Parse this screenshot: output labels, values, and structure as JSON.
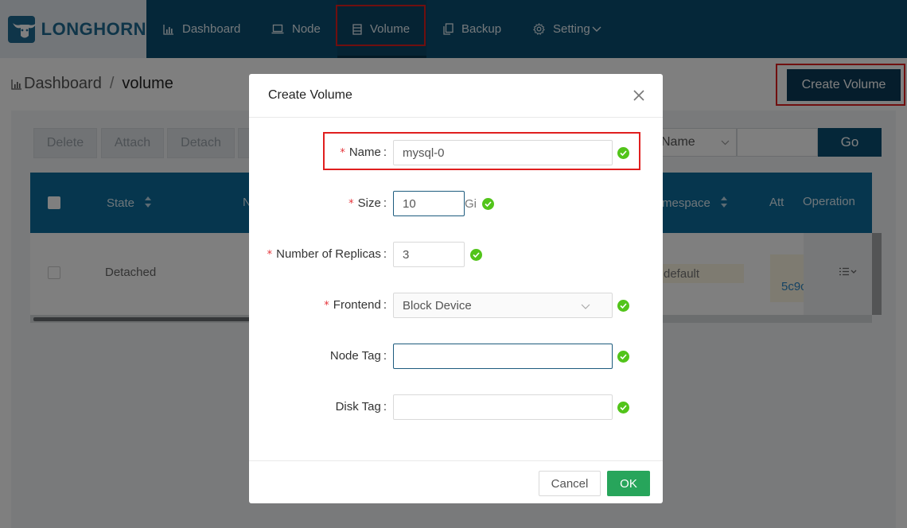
{
  "app": {
    "logo_text": "LONGHORN"
  },
  "nav": {
    "items": [
      {
        "label": "Dashboard",
        "icon": "bar-chart-icon"
      },
      {
        "label": "Node",
        "icon": "laptop-icon"
      },
      {
        "label": "Volume",
        "icon": "storage-icon",
        "active": true
      },
      {
        "label": "Backup",
        "icon": "copy-icon"
      },
      {
        "label": "Setting",
        "icon": "gear-icon"
      }
    ]
  },
  "breadcrumb": {
    "root": "Dashboard",
    "separator": "/",
    "current": "volume"
  },
  "header": {
    "create_label": "Create Volume"
  },
  "toolbar": {
    "delete_label": "Delete",
    "attach_label": "Attach",
    "detach_label": "Detach",
    "filter_value": "Name",
    "go_label": "Go"
  },
  "table": {
    "columns": [
      "State",
      "N",
      "mespace",
      "Att",
      "Operation"
    ],
    "rows": [
      {
        "state": "Detached",
        "namespace": "default",
        "attached": "5c9c"
      }
    ]
  },
  "modal": {
    "title": "Create Volume",
    "fields": {
      "name": {
        "label": "Name",
        "value": "mysql-0",
        "required": true
      },
      "size": {
        "label": "Size",
        "value": "10",
        "suffix": "Gi",
        "required": true
      },
      "replicas": {
        "label": "Number of Replicas",
        "value": "3",
        "required": true
      },
      "frontend": {
        "label": "Frontend",
        "value": "Block Device",
        "required": true
      },
      "node_tag": {
        "label": "Node Tag",
        "value": "",
        "required": false
      },
      "disk_tag": {
        "label": "Disk Tag",
        "value": "",
        "required": false
      }
    },
    "required_mark": "*",
    "colon": ":",
    "cancel_label": "Cancel",
    "ok_label": "OK"
  },
  "colors": {
    "nav_bg": "#0a4f73",
    "primary_dark": "#0a3b58",
    "ok_green": "#27a55b",
    "success_icon": "#52c41a",
    "highlight_red": "#e01f1f",
    "required_red": "#e5343a"
  }
}
